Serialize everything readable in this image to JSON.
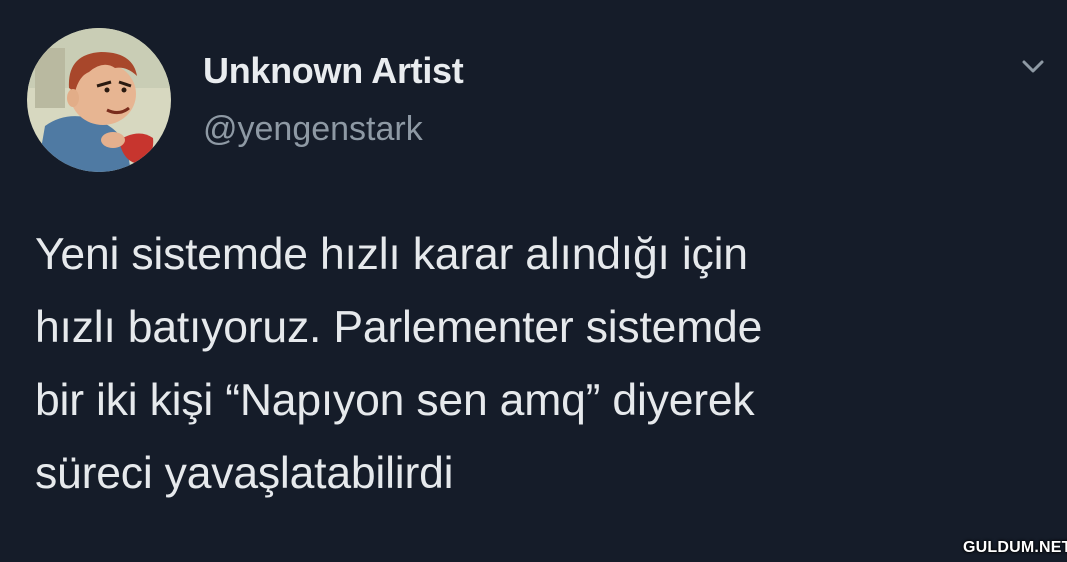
{
  "tweet": {
    "author": {
      "display_name": "Unknown Artist",
      "handle": "@yengenstark"
    },
    "text_lines": [
      "Yeni sistemde hızlı karar alındığı için",
      "hızlı batıyoruz. Parlementer sistemde",
      "bir iki kişi “Napıyon sen amq” diyerek",
      "süreci yavaşlatabilirdi"
    ],
    "menu_icon": "chevron-down-icon"
  },
  "watermark": "GULDUM.NET",
  "colors": {
    "background": "#151c29",
    "text_primary": "#e6e9ec",
    "text_secondary": "#8e99a4"
  }
}
